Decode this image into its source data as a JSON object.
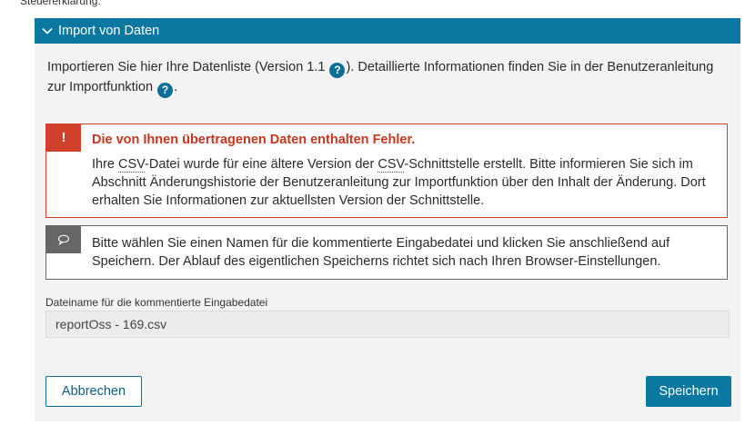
{
  "top_text": "Steuererklärung.",
  "panel": {
    "header_label": "Import von Daten"
  },
  "intro": {
    "part1": "Importieren Sie hier Ihre Datenliste (Version 1.1 ",
    "part2": "). Detaillierte Informationen finden Sie in der Benutzeranleitung zur Importfunktion ",
    "part3": ".",
    "help_glyph": "?"
  },
  "error_alert": {
    "icon_glyph": "!",
    "title": "Die von Ihnen übertragenen Daten enthalten Fehler.",
    "body_part1": "Ihre ",
    "abbr1": "CSV",
    "body_part2": "-Datei wurde für eine ältere Version der ",
    "abbr2": "CSV",
    "body_part3": "-Schnittstelle erstellt. Bitte informieren Sie sich im Abschnitt Änderungshistorie der Benutzeranleitung zur Importfunktion über den Inhalt der Änderung. Dort erhalten Sie Informationen zur aktuellsten Version der Schnittstelle."
  },
  "info_alert": {
    "icon": "speech-bubble-icon",
    "text": "Bitte wählen Sie einen Namen für die kommentierte Eingabedatei und klicken Sie anschließend auf Speichern. Der Ablauf des eigentlichen Speicherns richtet sich nach Ihren Browser-Einstellungen."
  },
  "filename": {
    "label": "Dateiname für die kommentierte Eingabedatei",
    "value": "reportOss - 169.csv"
  },
  "buttons": {
    "cancel": "Abbrechen",
    "save": "Speichern"
  },
  "colors": {
    "primary": "#0a78a0",
    "error": "#d0402b",
    "info": "#666666",
    "panel_bg": "#f3f3f3"
  }
}
